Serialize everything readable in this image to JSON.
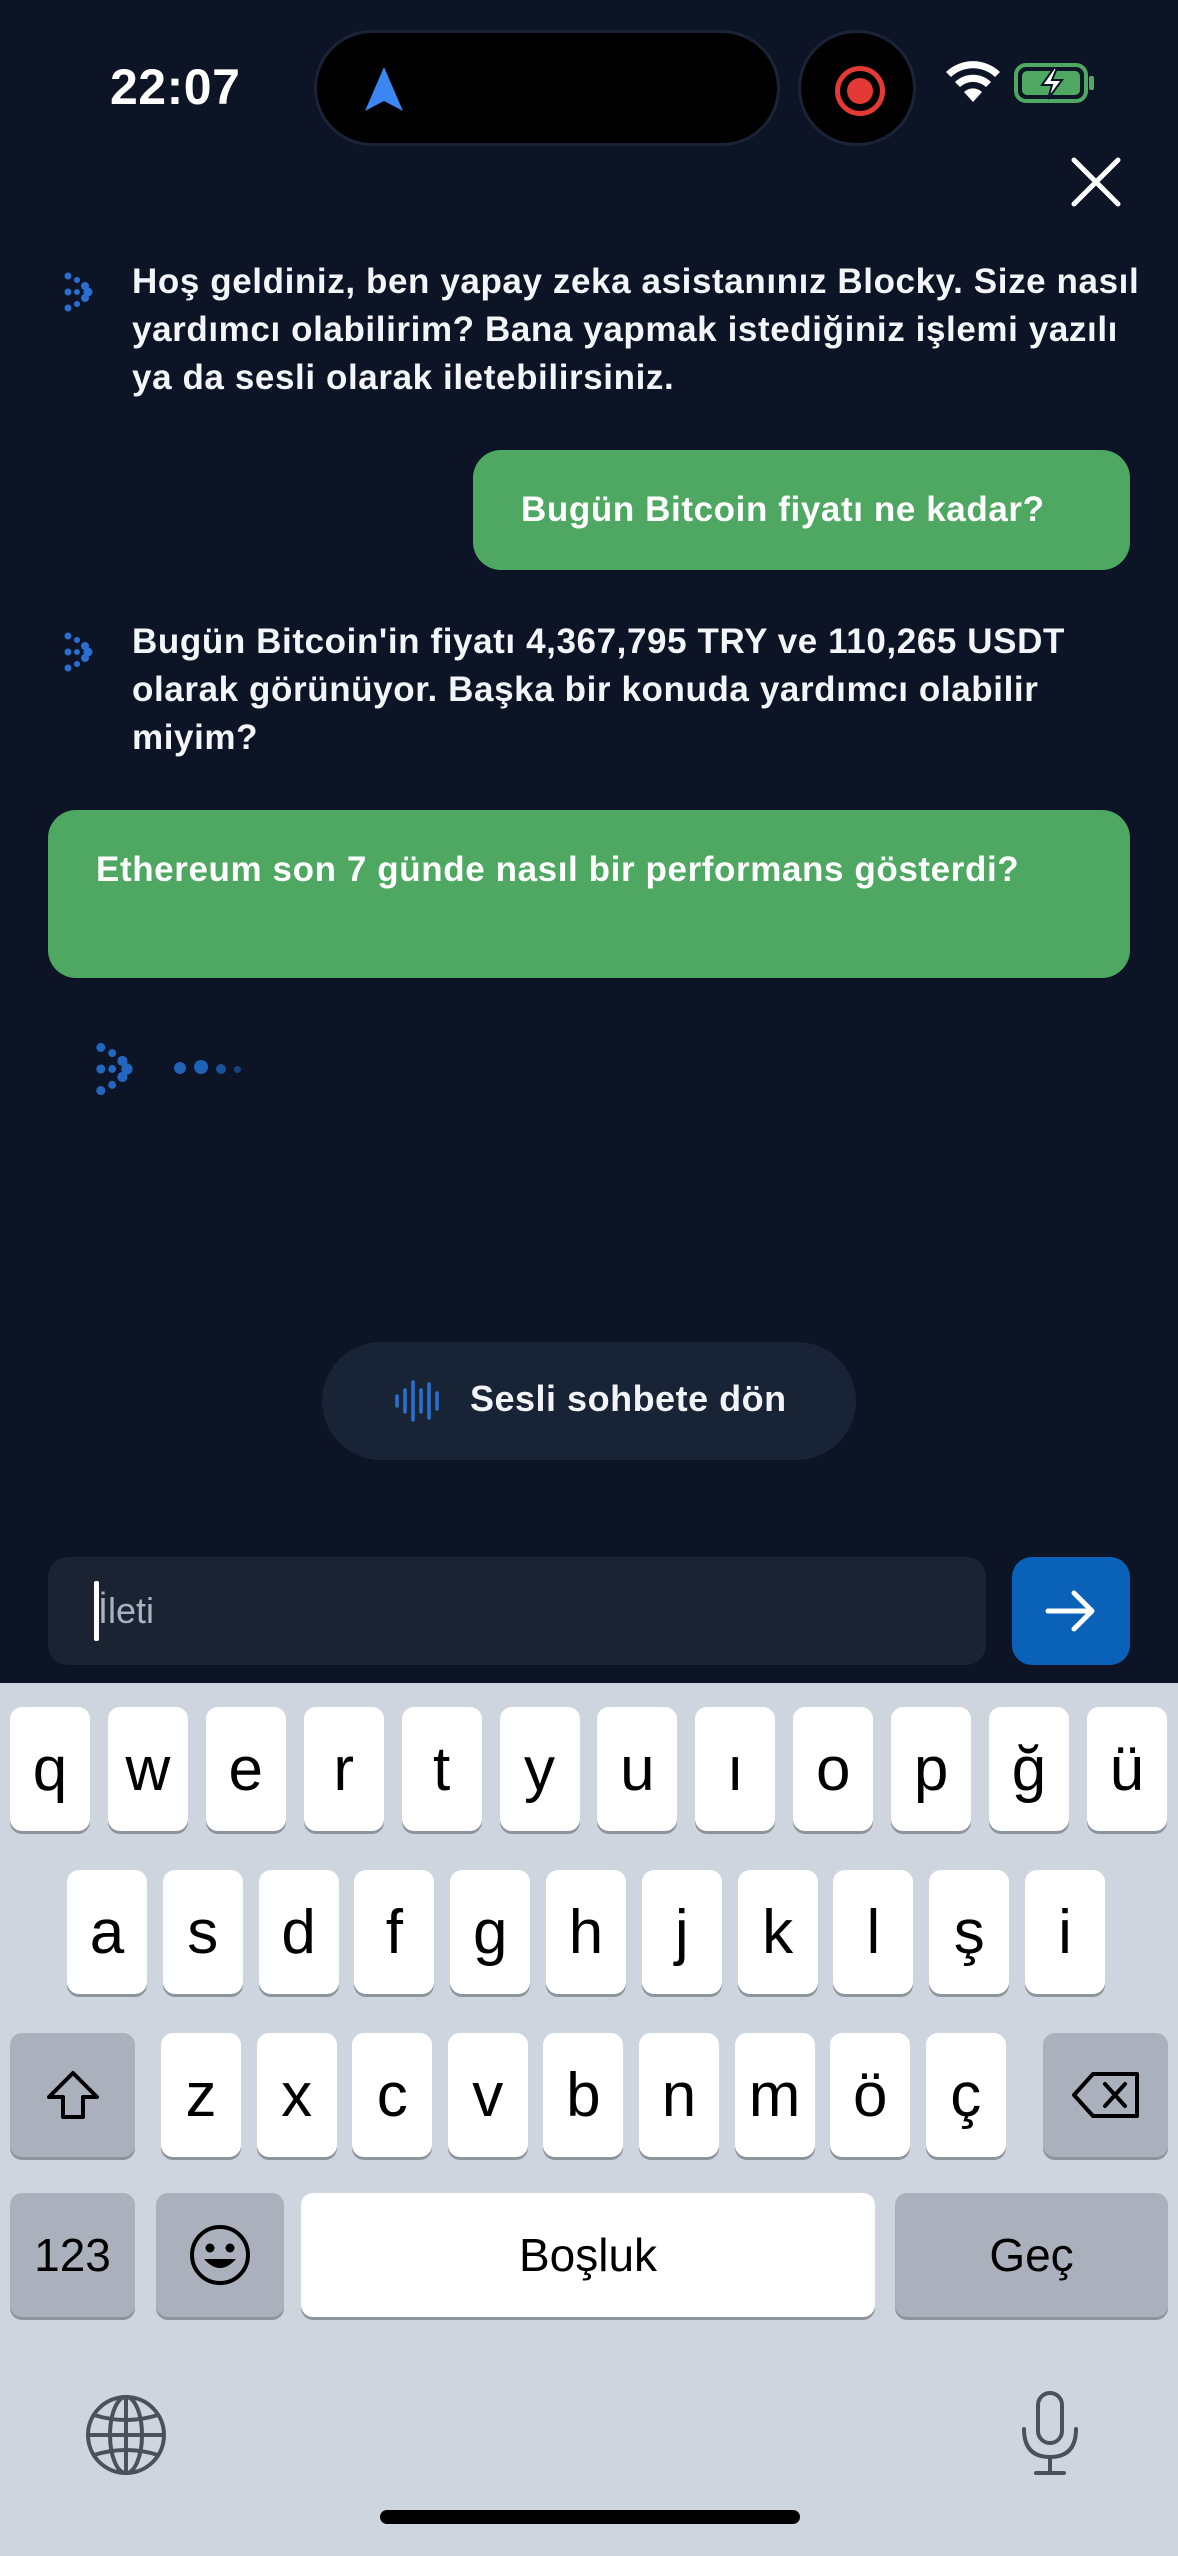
{
  "status_bar": {
    "time": "22:07"
  },
  "messages": [
    {
      "role": "bot",
      "text": "Hoş geldiniz, ben yapay zeka asistanınız Blocky. Size nasıl yardımcı olabilirim? Bana yapmak istediğiniz işlemi yazılı ya da sesli olarak iletebilirsiniz."
    },
    {
      "role": "user",
      "text": "Bugün Bitcoin fiyatı ne kadar?"
    },
    {
      "role": "bot",
      "text": "Bugün Bitcoin'in fiyatı 4,367,795 TRY ve 110,265 USDT olarak görünüyor. Başka bir konuda yardımcı olabilir miyim?"
    },
    {
      "role": "user",
      "text": "Ethereum son 7 günde nasıl bir performans gösterdi?"
    }
  ],
  "voice_chat_button": {
    "label": "Sesli sohbete dön"
  },
  "input": {
    "placeholder": "İleti",
    "value": ""
  },
  "keyboard": {
    "row1": [
      "q",
      "w",
      "e",
      "r",
      "t",
      "y",
      "u",
      "ı",
      "o",
      "p",
      "ğ",
      "ü"
    ],
    "row2": [
      "a",
      "s",
      "d",
      "f",
      "g",
      "h",
      "j",
      "k",
      "l",
      "ş",
      "i"
    ],
    "row3": [
      "z",
      "x",
      "c",
      "v",
      "b",
      "n",
      "m",
      "ö",
      "ç"
    ],
    "numbers_label": "123",
    "space_label": "Boşluk",
    "return_label": "Geç"
  },
  "colors": {
    "background": "#0c1425",
    "user_bubble": "#4ea862",
    "accent_blue": "#0a61b8",
    "keyboard_bg": "#cfd5de"
  },
  "icons": [
    "navigation-arrow-icon",
    "record-icon",
    "wifi-icon",
    "battery-charging-icon",
    "close-icon",
    "blocky-logo-icon",
    "sound-wave-icon",
    "arrow-right-icon",
    "shift-icon",
    "backspace-icon",
    "emoji-icon",
    "globe-icon",
    "microphone-icon"
  ]
}
